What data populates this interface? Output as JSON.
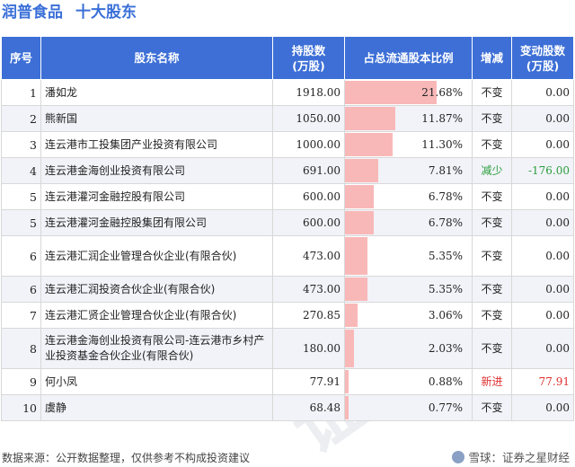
{
  "header": {
    "company": "润普食品",
    "subtitle": "十大股东"
  },
  "table": {
    "columns": [
      "序号",
      "股东名称",
      "持股数\n(万股)",
      "占总流通股本比例",
      "增减",
      "变动股数\n(万股)"
    ],
    "rows": [
      {
        "rank": "1",
        "name": "潘如龙",
        "shares": "1918.00",
        "ratio": "21.68%",
        "ratio_value": 21.68,
        "change": "不变",
        "amount": "0.00",
        "status": "same"
      },
      {
        "rank": "2",
        "name": "熊新国",
        "shares": "1050.00",
        "ratio": "11.87%",
        "ratio_value": 11.87,
        "change": "不变",
        "amount": "0.00",
        "status": "same"
      },
      {
        "rank": "3",
        "name": "连云港市工投集团产业投资有限公司",
        "shares": "1000.00",
        "ratio": "11.30%",
        "ratio_value": 11.3,
        "change": "不变",
        "amount": "0.00",
        "status": "same"
      },
      {
        "rank": "4",
        "name": "连云港金海创业投资有限公司",
        "shares": "691.00",
        "ratio": "7.81%",
        "ratio_value": 7.81,
        "change": "减少",
        "amount": "-176.00",
        "status": "down"
      },
      {
        "rank": "5",
        "name": "连云港灌河金融控股有限公司",
        "shares": "600.00",
        "ratio": "6.78%",
        "ratio_value": 6.78,
        "change": "不变",
        "amount": "0.00",
        "status": "same"
      },
      {
        "rank": "5",
        "name": "连云港灌河金融控股集团有限公司",
        "shares": "600.00",
        "ratio": "6.78%",
        "ratio_value": 6.78,
        "change": "不变",
        "amount": "0.00",
        "status": "same"
      },
      {
        "rank": "6",
        "name": "连云港汇润企业管理合伙企业(有限合伙)",
        "shares": "473.00",
        "ratio": "5.35%",
        "ratio_value": 5.35,
        "change": "不变",
        "amount": "0.00",
        "status": "same"
      },
      {
        "rank": "6",
        "name": "连云港汇润投资合伙企业(有限合伙)",
        "shares": "473.00",
        "ratio": "5.35%",
        "ratio_value": 5.35,
        "change": "不变",
        "amount": "0.00",
        "status": "same"
      },
      {
        "rank": "7",
        "name": "连云港汇贤企业管理合伙企业(有限合伙)",
        "shares": "270.85",
        "ratio": "3.06%",
        "ratio_value": 3.06,
        "change": "不变",
        "amount": "0.00",
        "status": "same"
      },
      {
        "rank": "8",
        "name": "连云港金海创业投资有限公司-连云港市乡村产业投资基金合伙企业(有限合伙)",
        "shares": "180.00",
        "ratio": "2.03%",
        "ratio_value": 2.03,
        "change": "不变",
        "amount": "0.00",
        "status": "same"
      },
      {
        "rank": "9",
        "name": "何小凤",
        "shares": "77.91",
        "ratio": "0.88%",
        "ratio_value": 0.88,
        "change": "新进",
        "amount": "77.91",
        "status": "new"
      },
      {
        "rank": "10",
        "name": "虞静",
        "shares": "68.48",
        "ratio": "0.77%",
        "ratio_value": 0.77,
        "change": "不变",
        "amount": "0.00",
        "status": "same"
      }
    ]
  },
  "watermark": [
    "证券之星",
    "证券之星"
  ],
  "footer": {
    "source": "数据来源：公开数据整理，仅供参考不构成投资建议",
    "brand": "雪球：证券之星财经"
  },
  "colors": {
    "header_bg": "#3d6fd6",
    "title": "#3a6fd8",
    "bar": "#f9b8b8",
    "down": "#2a9d3c",
    "new": "#e03030"
  }
}
